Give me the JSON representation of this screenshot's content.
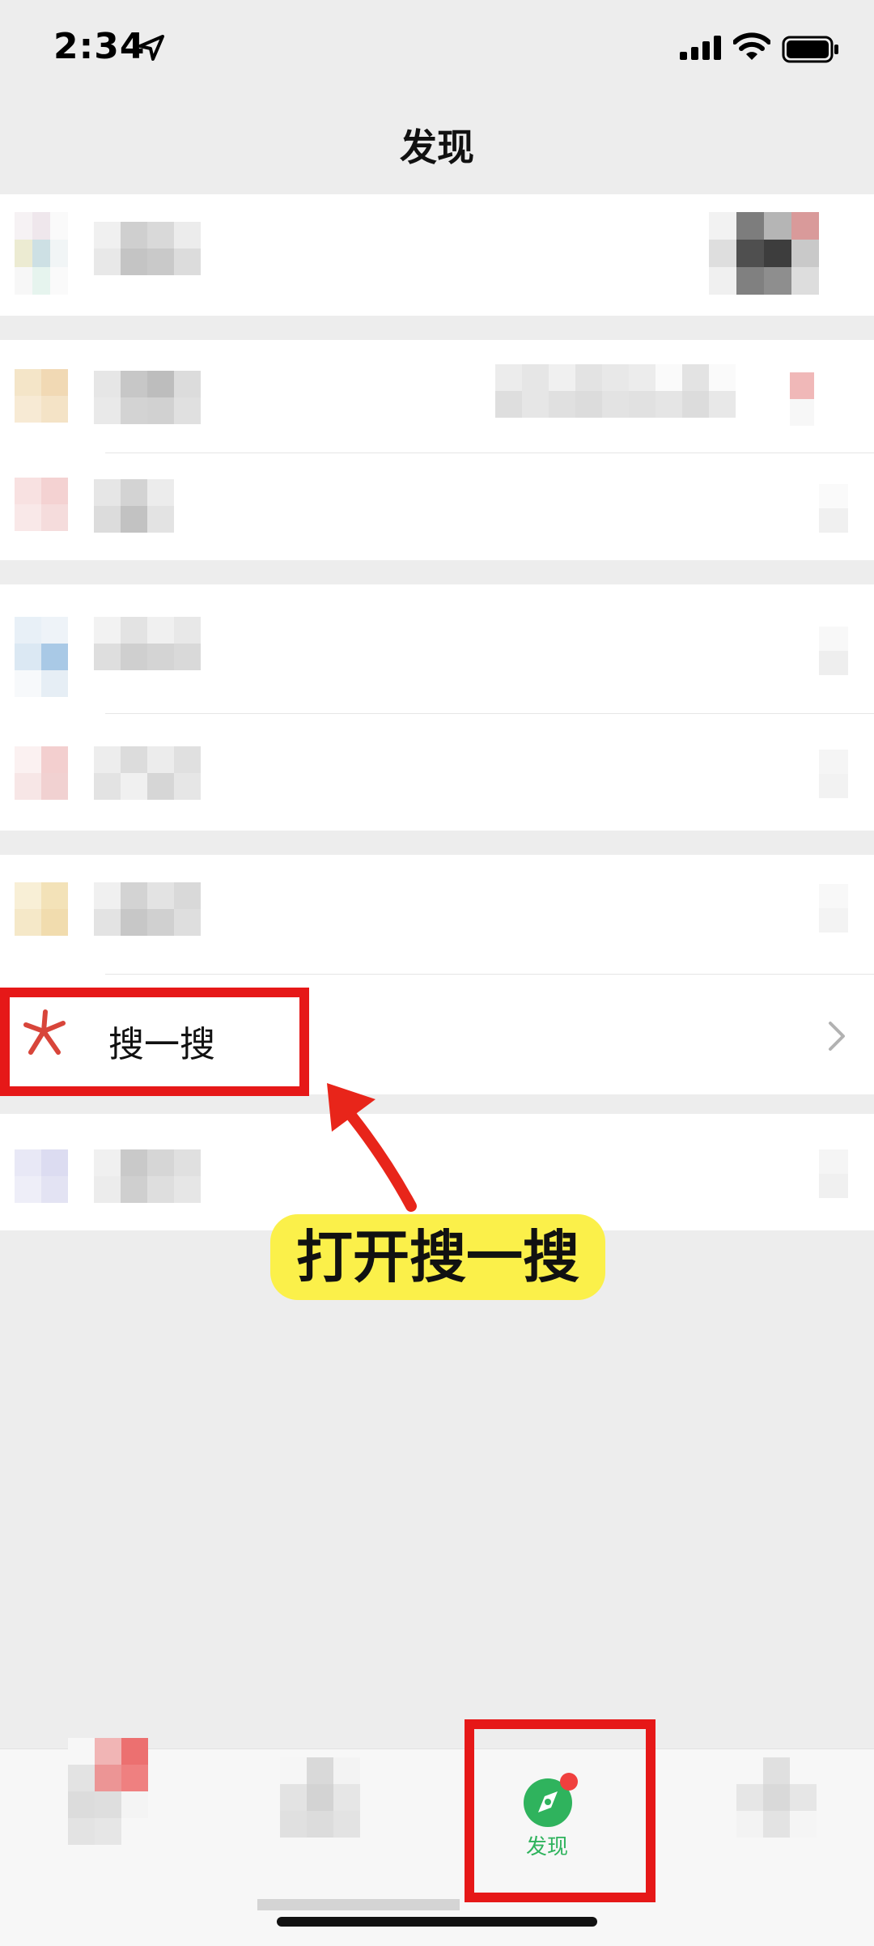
{
  "status_bar": {
    "time": "2:34",
    "icons": [
      "location-arrow-icon",
      "cellular-signal-icon",
      "wifi-icon",
      "battery-icon"
    ]
  },
  "nav": {
    "title": "发现"
  },
  "rows": {
    "search": {
      "label": "搜一搜",
      "icon": "search-sparkle-icon"
    }
  },
  "annotation": {
    "callout_text": "打开搜一搜",
    "callout_color": "#fbf04a",
    "highlight_color": "#e61818"
  },
  "tabbar": {
    "active_label": "发现",
    "active_color": "#2fb35d",
    "active_badge_color": "#f0403e"
  }
}
